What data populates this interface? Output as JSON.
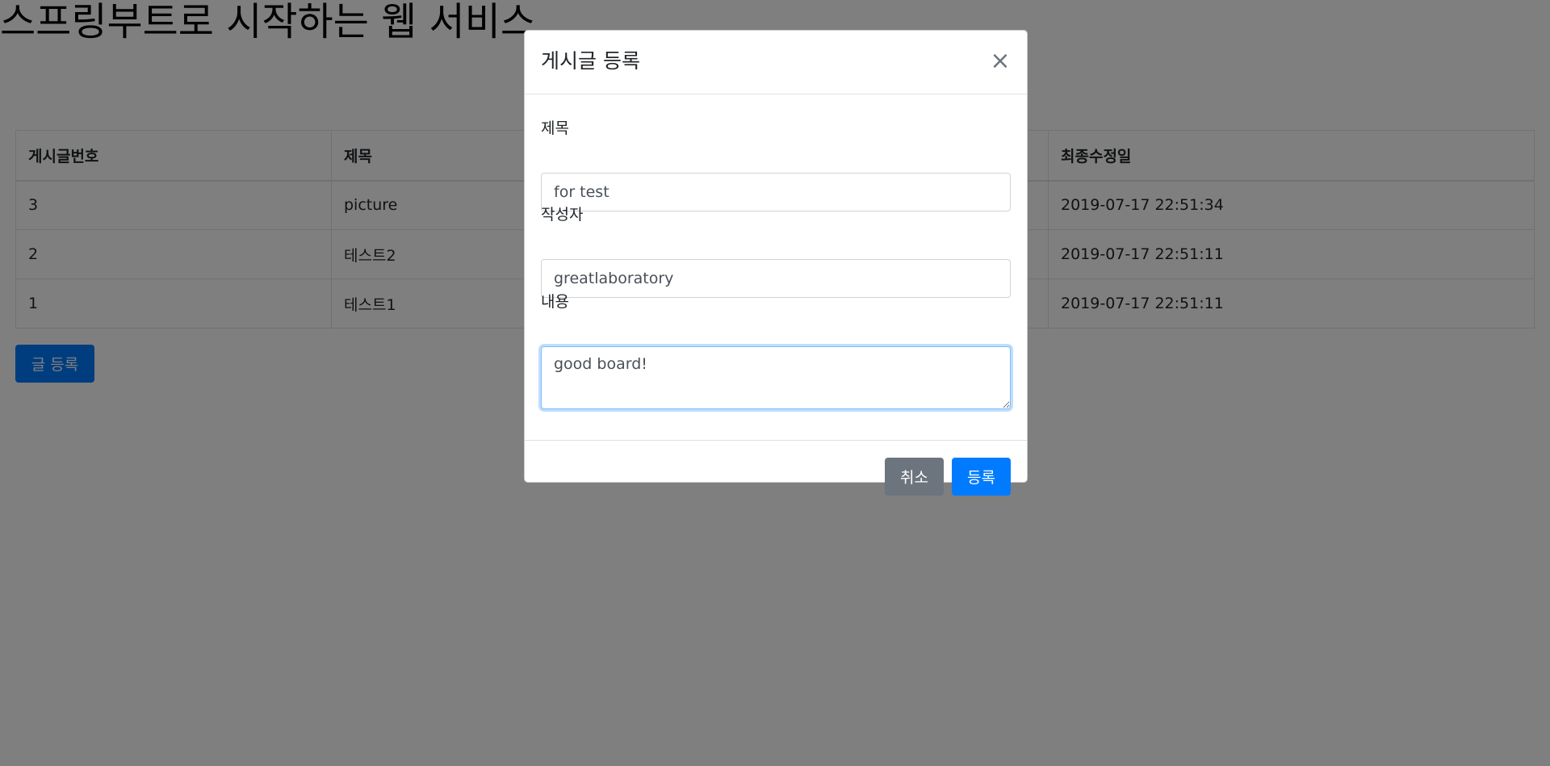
{
  "page": {
    "title": "스프링부트로 시작하는 웹 서비스"
  },
  "table": {
    "headers": [
      "게시글번호",
      "제목",
      "최종수정일"
    ],
    "rows": [
      [
        "3",
        "picture",
        "2019-07-17 22:51:34"
      ],
      [
        "2",
        "테스트2",
        "2019-07-17 22:51:11"
      ],
      [
        "1",
        "테스트1",
        "2019-07-17 22:51:11"
      ]
    ]
  },
  "write_button_label": "글 등록",
  "modal": {
    "title": "게시글 등록",
    "close_glyph": "×",
    "fields": {
      "title_label": "제목",
      "title_value": "for test",
      "author_label": "작성자",
      "author_value": "greatlaboratory",
      "content_label": "내용",
      "content_value": "good board!"
    },
    "cancel_label": "취소",
    "save_label": "등록"
  },
  "colors": {
    "primary": "#007bff",
    "secondary": "#6c757d",
    "backdrop": "rgba(0,0,0,0.5)"
  }
}
